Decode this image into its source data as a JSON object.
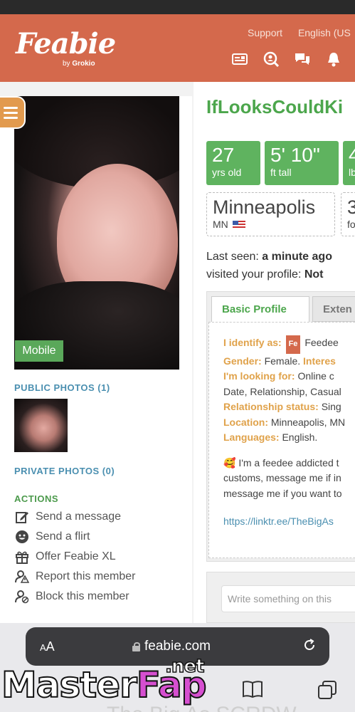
{
  "header": {
    "logo": "Feabie",
    "logo_sub_prefix": "by",
    "logo_sub_brand": "Grokio",
    "links": [
      "Support",
      "English (US"
    ],
    "icons": [
      "news-icon",
      "search-profile-icon",
      "messages-icon",
      "notifications-icon"
    ]
  },
  "profile": {
    "username": "IfLooksCouldKi",
    "photo_badge": "Mobile",
    "stats": [
      {
        "big": "27",
        "small": "yrs old"
      },
      {
        "big": "5' 10\"",
        "small": "ft tall"
      },
      {
        "big": "4",
        "small": "lbs"
      }
    ],
    "location": {
      "city": "Minneapolis",
      "state": "MN"
    },
    "location2": {
      "big": "3",
      "small": "fo"
    },
    "last_seen_label": "Last seen:",
    "last_seen_value": "a minute ago",
    "visited_label": "visited your profile:",
    "visited_value": "Not"
  },
  "left": {
    "public_photos": "PUBLIC PHOTOS (1)",
    "private_photos": "PRIVATE PHOTOS (0)",
    "actions_title": "ACTIONS",
    "actions": [
      {
        "label": "Send a message",
        "icon": "edit-icon"
      },
      {
        "label": "Send a flirt",
        "icon": "smiley-icon"
      },
      {
        "label": "Offer Feabie XL",
        "icon": "gift-icon"
      },
      {
        "label": "Report this member",
        "icon": "report-user-icon"
      },
      {
        "label": "Block this member",
        "icon": "block-user-icon"
      }
    ]
  },
  "tabs": {
    "active": "Basic Profile",
    "inactive": "Exten"
  },
  "basic": {
    "identify_label": "I identify as:",
    "identify_badge": "Fe",
    "identify_value": "Feedee",
    "gender_label": "Gender:",
    "gender_value": "Female.",
    "interest_label": "Interes",
    "looking_label": "I'm looking for:",
    "looking_value": "Online c",
    "looking_value2": "Date, Relationship, Casual",
    "relationship_label": "Relationship status:",
    "relationship_value": "Sing",
    "location_label": "Location:",
    "location_value": "Minneapolis, MN",
    "languages_label": "Languages:",
    "languages_value": "English.",
    "bio_lines": [
      "🥰 I'm a feedee addicted t",
      "customs, message me if in",
      "message me if you want to"
    ],
    "link": "https://linktr.ee/TheBigAs"
  },
  "comment": {
    "placeholder": "Write something on this"
  },
  "browser": {
    "aa_small": "A",
    "aa_big": "A",
    "url": "feabie.com"
  },
  "watermark": {
    "master": "Master",
    "fap": "Fap",
    "net": ".net"
  },
  "ghost": "The Big As SCRDW"
}
